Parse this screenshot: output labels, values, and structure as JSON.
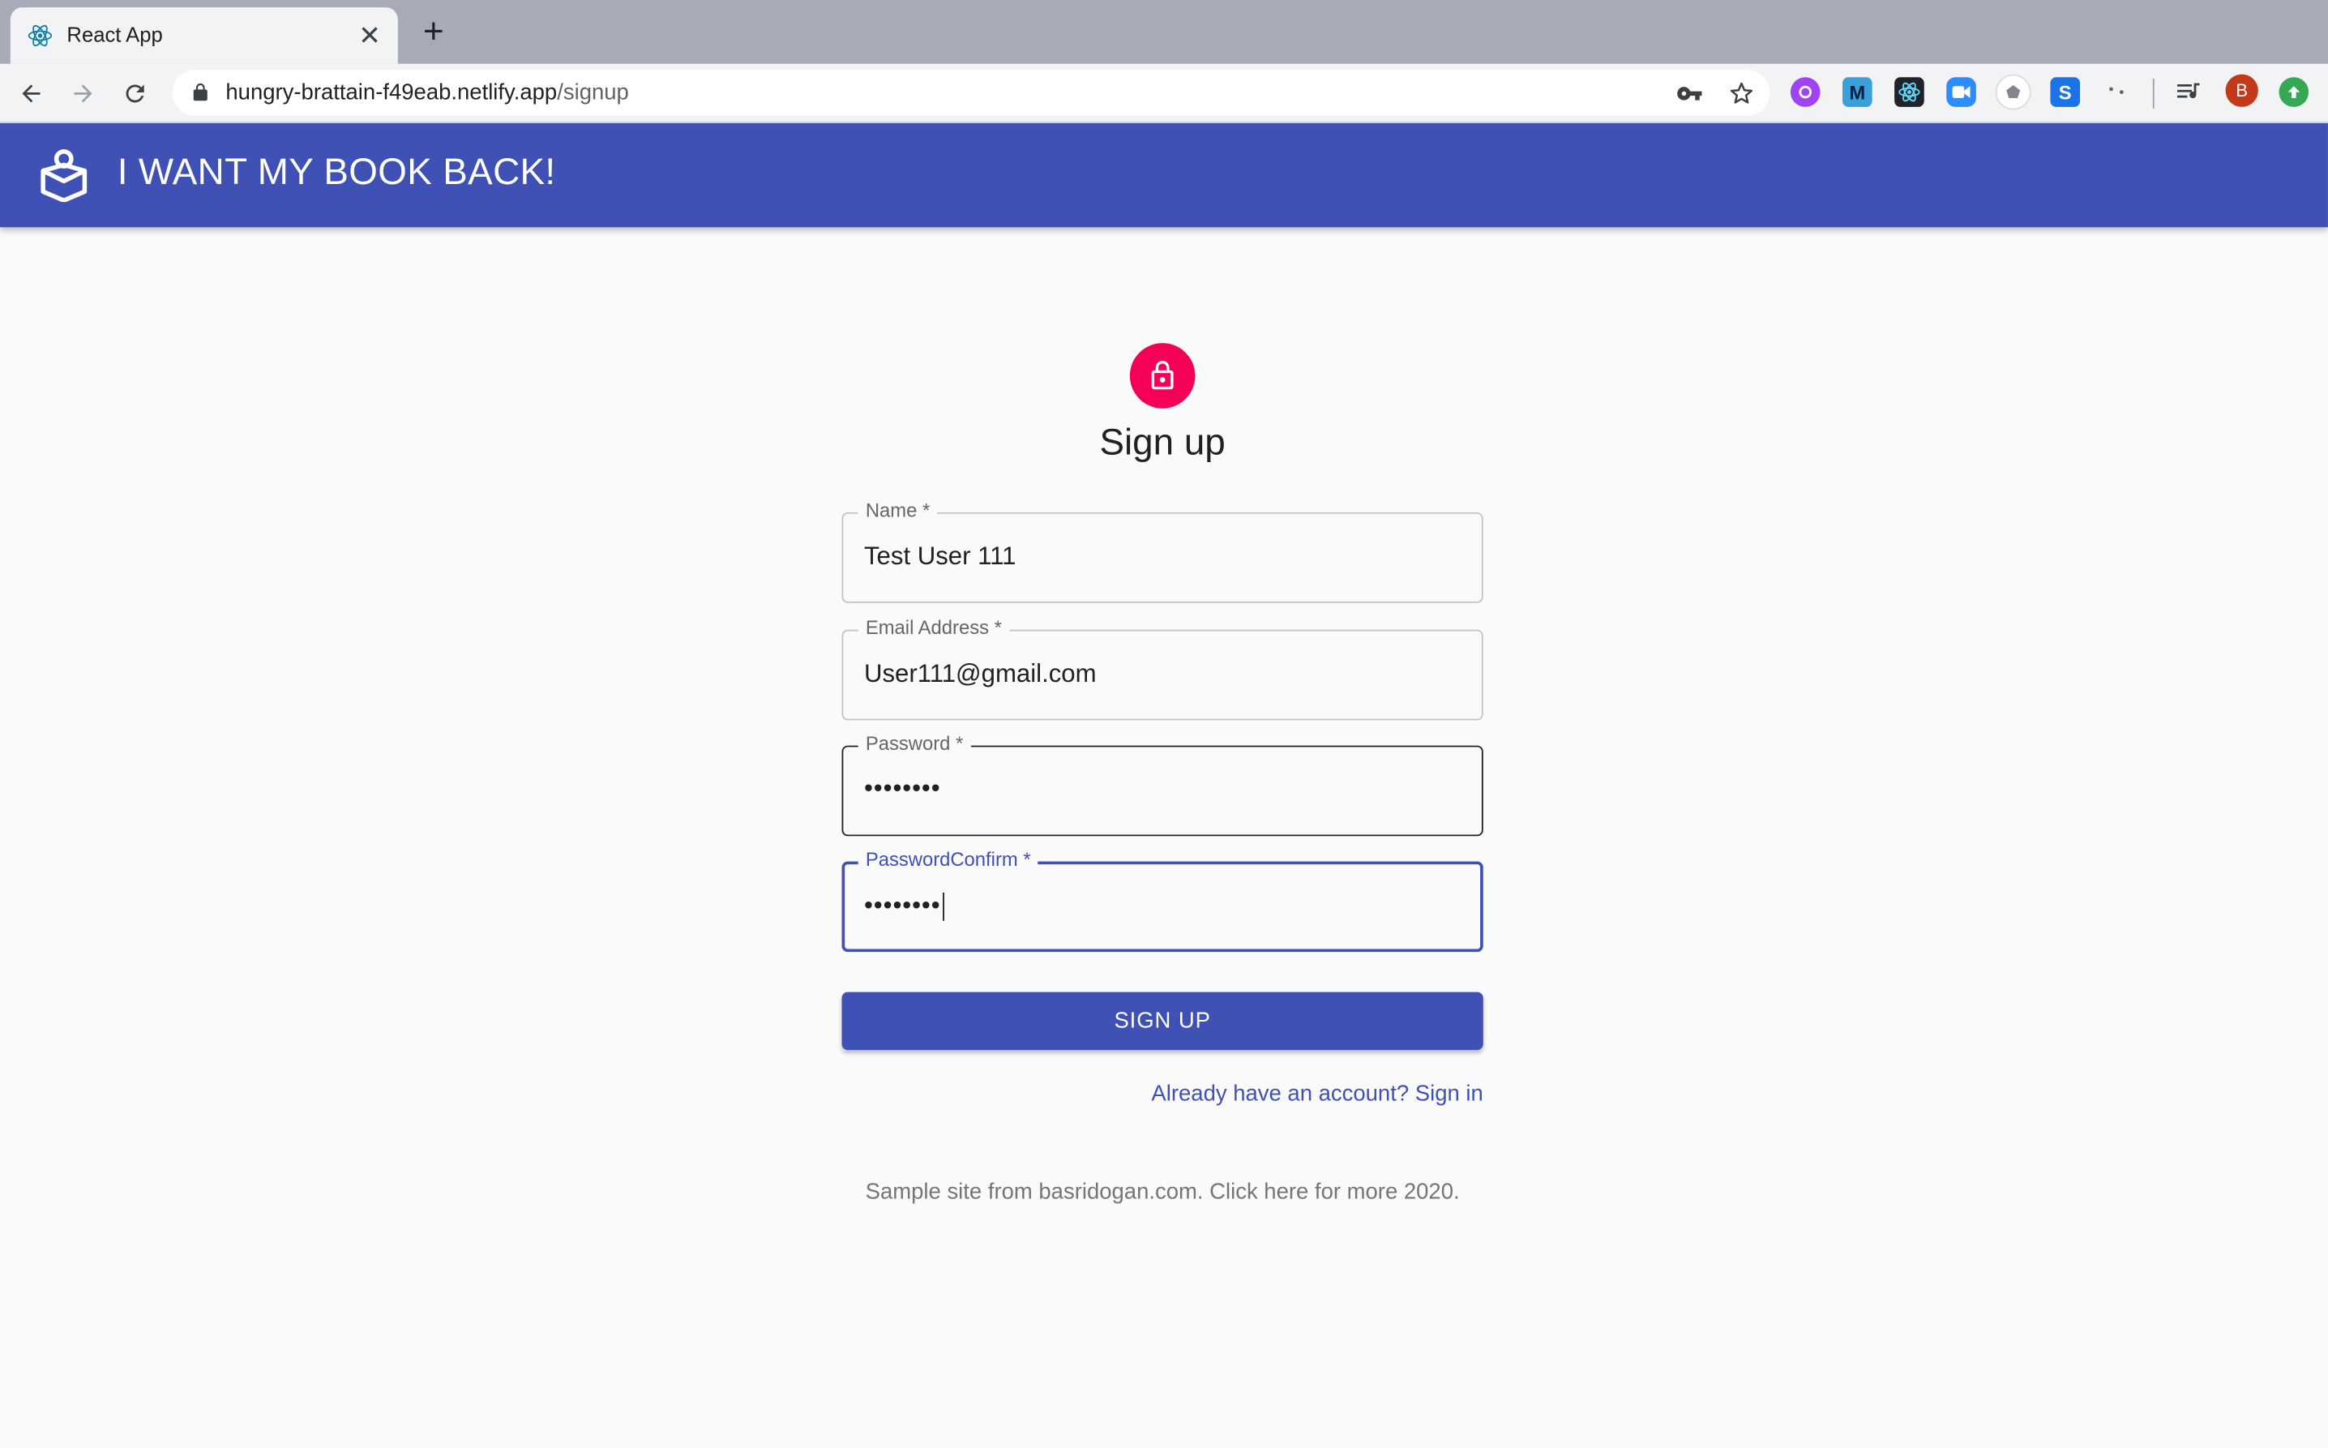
{
  "browser": {
    "tab_title": "React App",
    "close_glyph": "✕",
    "new_tab_glyph": "+",
    "url_host": "hungry-brattain-f49eab.netlify.app",
    "url_path": "/signup",
    "profile_initial": "B",
    "extensions": [
      {
        "name": "extension-purple",
        "color": "#a142f4"
      },
      {
        "name": "extension-m",
        "label": "M",
        "color": "#1a73e8"
      },
      {
        "name": "react-devtools",
        "color": "#20232a"
      },
      {
        "name": "zoom-extension",
        "color": "#2d8cff"
      },
      {
        "name": "extension-puzzle",
        "color": "#5f6368"
      },
      {
        "name": "extension-s",
        "label": "S",
        "color": "#1a73e8"
      }
    ]
  },
  "app": {
    "title": "I WANT MY BOOK BACK!",
    "primary_color": "#3f51b5",
    "accent_color": "#f50057"
  },
  "form": {
    "heading": "Sign up",
    "fields": [
      {
        "label": "Name *",
        "value": "Test User 111"
      },
      {
        "label": "Email Address *",
        "value": "User111@gmail.com"
      },
      {
        "label": "Password *",
        "value": "••••••••"
      },
      {
        "label": "PasswordConfirm *",
        "value": "••••••••"
      }
    ],
    "submit_label": "SIGN UP",
    "signin_link": "Already have an account? Sign in"
  },
  "footer": {
    "text": "Sample site from basridogan.com. Click here for more 2020."
  }
}
